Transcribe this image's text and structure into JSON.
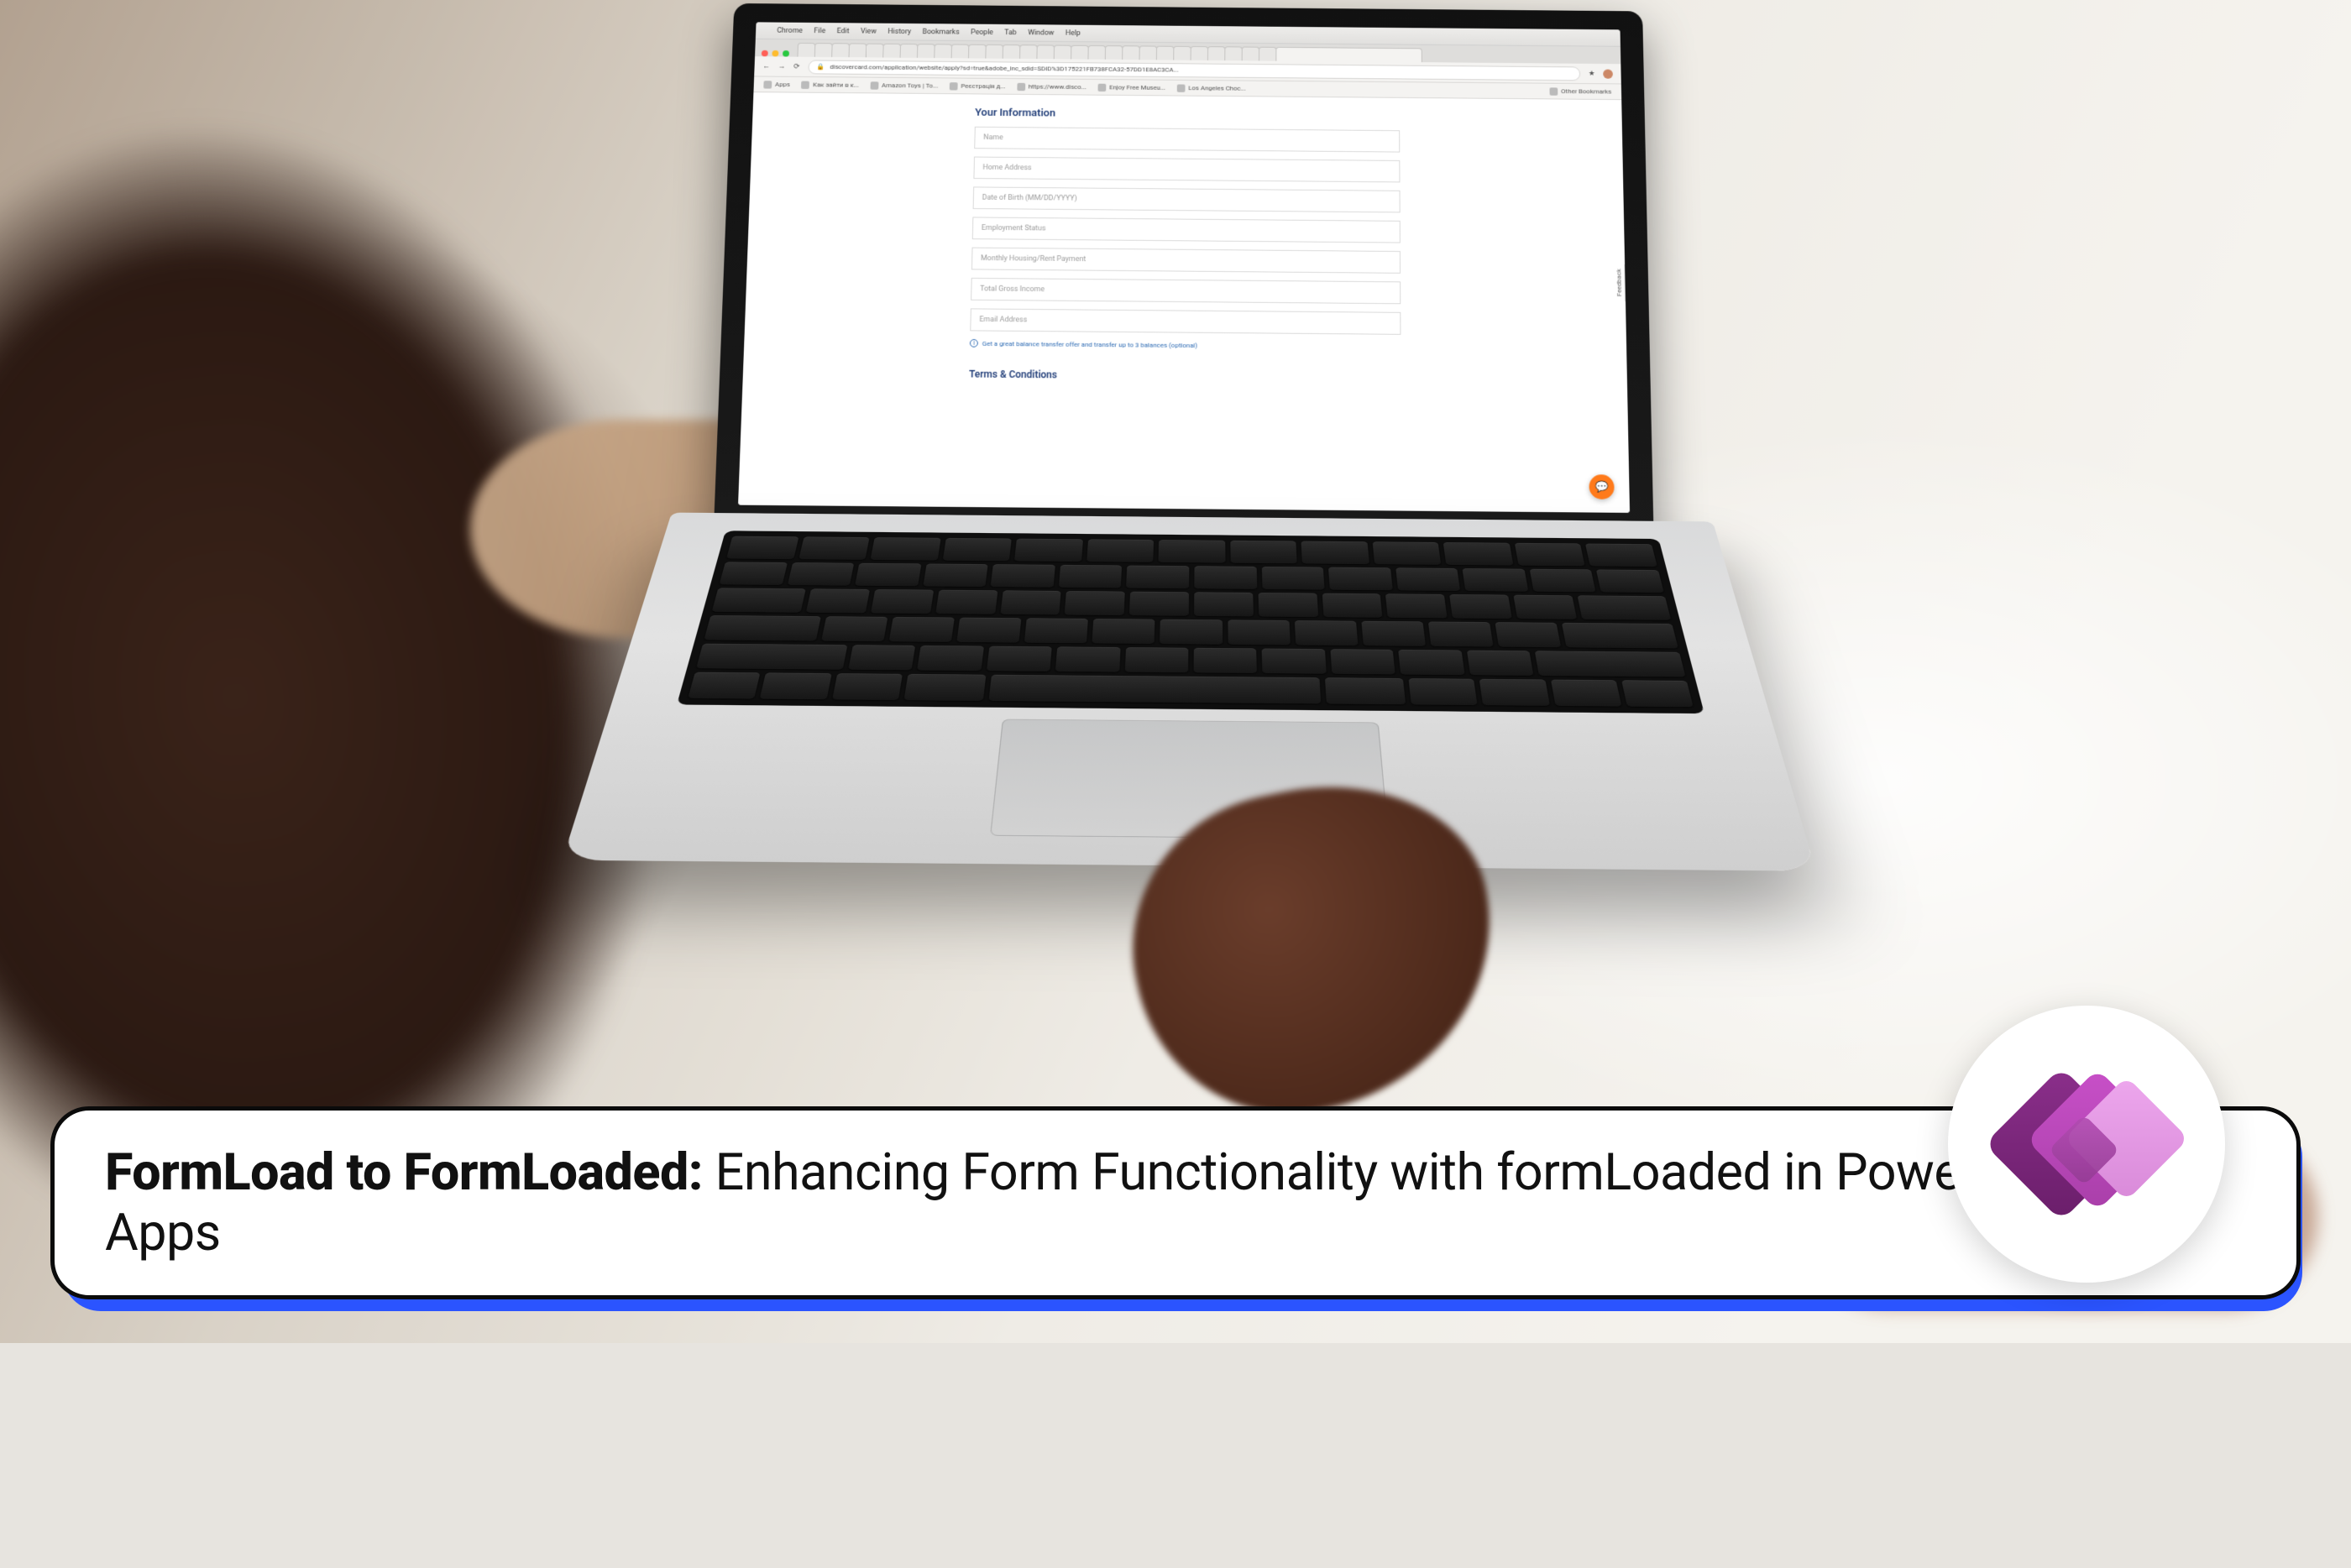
{
  "menubar": {
    "items": [
      "Chrome",
      "File",
      "Edit",
      "View",
      "History",
      "Bookmarks",
      "People",
      "Tab",
      "Window",
      "Help"
    ]
  },
  "browser": {
    "url": "discovercard.com/application/website/apply?sd=true&adobe_inc_sdid=SDID%3D175221FB738FCA32-57DD1E8AC3CA...",
    "bookmarks": [
      "Apps",
      "Как зайти в к...",
      "Amazon Toys | To...",
      "Реєстрація д...",
      "https://www.disco...",
      "Enjoy Free Museu...",
      "Los Angeles Choc..."
    ],
    "other_bookmarks_label": "Other Bookmarks"
  },
  "form": {
    "title": "Your Information",
    "fields": [
      "Name",
      "Home Address",
      "Date of Birth (MM/DD/YYYY)",
      "Employment Status",
      "Monthly Housing/Rent Payment",
      "Total Gross Income",
      "Email Address"
    ],
    "note": "Get a great balance transfer offer and transfer up to 3 balances (optional)",
    "terms_title": "Terms & Conditions",
    "feedback_label": "Feedback"
  },
  "banner": {
    "bold": "FormLoad to FormLoaded:",
    "rest": " Enhancing Form Functionality with formLoaded in Power Apps"
  }
}
